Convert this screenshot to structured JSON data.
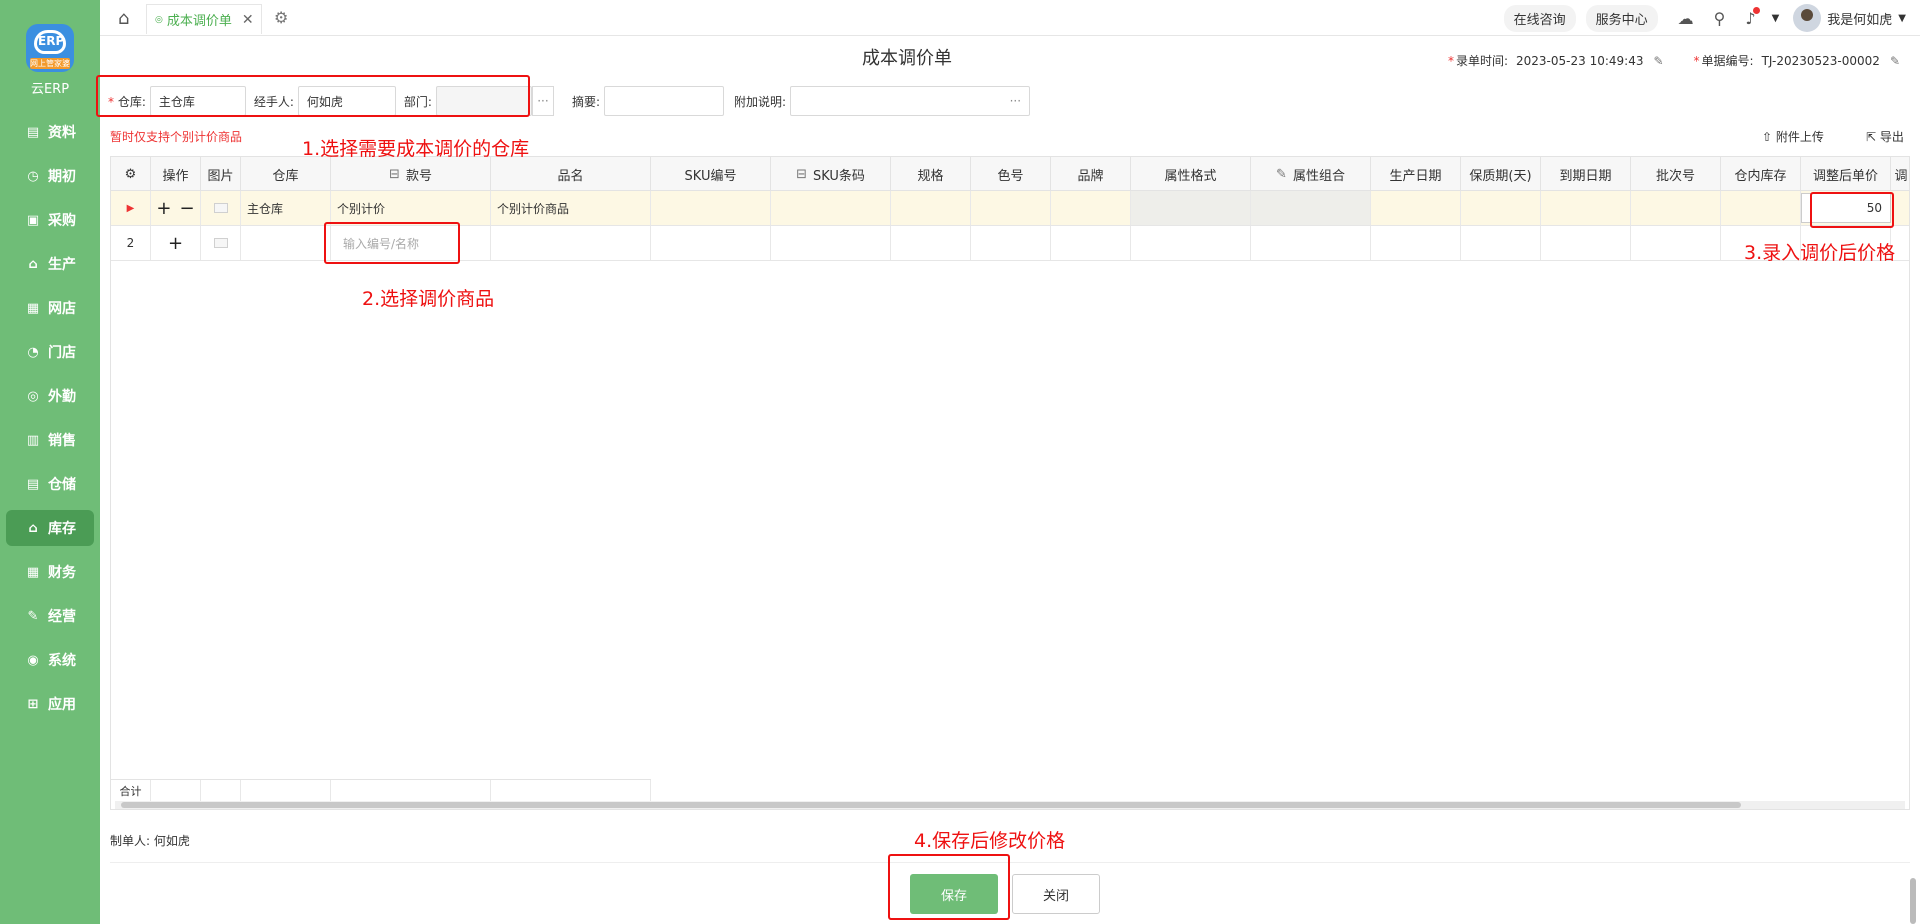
{
  "logo": {
    "badge_text": "ERP",
    "badge_strip": "网上管家婆",
    "title": "云ERP"
  },
  "sidebar": {
    "items": [
      {
        "label": "资料",
        "icon": "data-icon",
        "glyph": "▤"
      },
      {
        "label": "期初",
        "icon": "clock-icon",
        "glyph": "◷"
      },
      {
        "label": "采购",
        "icon": "cart-icon",
        "glyph": "▣"
      },
      {
        "label": "生产",
        "icon": "factory-icon",
        "glyph": "⌂"
      },
      {
        "label": "网店",
        "icon": "shop-icon",
        "glyph": "▦"
      },
      {
        "label": "门店",
        "icon": "store-icon",
        "glyph": "◔"
      },
      {
        "label": "外勤",
        "icon": "field-icon",
        "glyph": "◎"
      },
      {
        "label": "销售",
        "icon": "sales-icon",
        "glyph": "▥"
      },
      {
        "label": "仓储",
        "icon": "warehouse-icon",
        "glyph": "▤"
      },
      {
        "label": "库存",
        "icon": "inventory-icon",
        "glyph": "⌂"
      },
      {
        "label": "财务",
        "icon": "finance-icon",
        "glyph": "▦"
      },
      {
        "label": "经营",
        "icon": "business-icon",
        "glyph": "✎"
      },
      {
        "label": "系统",
        "icon": "system-icon",
        "glyph": "◉"
      },
      {
        "label": "应用",
        "icon": "apps-icon",
        "glyph": "⊞"
      }
    ],
    "active": "库存"
  },
  "topbar": {
    "tab_label": "成本调价单",
    "online_consult": "在线咨询",
    "service_center": "服务中心",
    "user_name": "我是何如虎"
  },
  "page": {
    "title": "成本调价单",
    "entry_time_label": "录单时间:",
    "entry_time": "2023-05-23 10:49:43",
    "doc_no_label": "单据编号:",
    "doc_no": "TJ-20230523-00002"
  },
  "form": {
    "warehouse_label": "仓库:",
    "warehouse_value": "主仓库",
    "handler_label": "经手人:",
    "handler_value": "何如虎",
    "dept_label": "部门:",
    "dept_value": "",
    "summary_label": "摘要:",
    "summary_value": "",
    "note_label": "附加说明:",
    "note_value": ""
  },
  "hint": "暂时仅支持个别计价商品",
  "actions": {
    "upload": "附件上传",
    "export": "导出"
  },
  "grid": {
    "columns": [
      "操作",
      "图片",
      "仓库",
      "款号",
      "品名",
      "SKU编号",
      "SKU条码",
      "规格",
      "色号",
      "品牌",
      "属性格式",
      "属性组合",
      "生产日期",
      "保质期(天)",
      "到期日期",
      "批次号",
      "仓内库存",
      "调整后单价",
      "调"
    ],
    "rows": [
      {
        "num": "",
        "warehouse": "主仓库",
        "code": "个别计价",
        "name": "个别计价商品",
        "adjusted_price": "50"
      },
      {
        "num": "2",
        "warehouse": "",
        "code_placeholder": "输入编号/名称",
        "name": "",
        "adjusted_price": ""
      }
    ],
    "total_label": "合计"
  },
  "creator": {
    "label": "制单人:",
    "name": "何如虎"
  },
  "buttons": {
    "save": "保存",
    "close": "关闭"
  },
  "annotations": {
    "a1": "1.选择需要成本调价的仓库",
    "a2": "2.选择调价商品",
    "a3": "3.录入调价后价格",
    "a4": "4.保存后修改价格"
  }
}
